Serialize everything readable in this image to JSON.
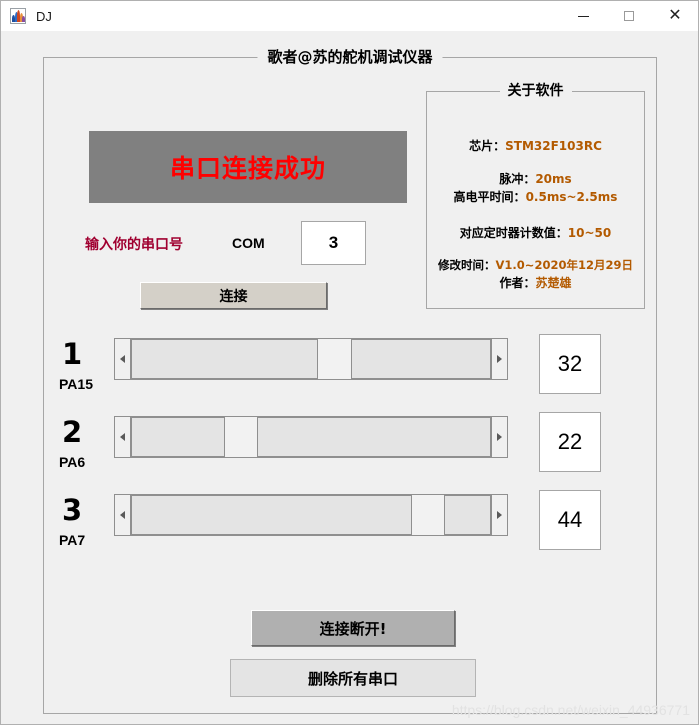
{
  "window": {
    "title": "DJ",
    "icon": "matlab-icon",
    "controls": {
      "minimize": "minimize-icon",
      "maximize": "maximize-icon",
      "close": "close-icon"
    }
  },
  "main_panel": {
    "title": "歌者@苏的舵机调试仪器"
  },
  "status": {
    "text": "串口连接成功",
    "text_color": "#ff0000",
    "background_color": "#808080"
  },
  "com": {
    "prompt": "输入你的串口号",
    "prompt_color": "#a00030",
    "label": "COM",
    "value": "3",
    "placeholder": ""
  },
  "buttons": {
    "connect": "连接",
    "disconnect": "连接断开!",
    "clear_ports": "删除所有串口"
  },
  "about": {
    "title": "关于软件",
    "chip_label": "芯片：",
    "chip_value": "STM32F103RC",
    "pulse_label": "脉冲：",
    "pulse_value": "20ms",
    "high_label": "高电平时间：",
    "high_value": "0.5ms~2.5ms",
    "timer_label": "对应定时器计数值：",
    "timer_value": "10~50",
    "version_label": "修改时间：",
    "version_value": "V1.0~2020年12月29日",
    "author_label": "作者：",
    "author_value": "苏楚雄",
    "value_color": "#b35a00"
  },
  "sliders": [
    {
      "index": "1",
      "pin": "PA15",
      "value": "32",
      "thumb_percent": 55
    },
    {
      "index": "2",
      "pin": "PA6",
      "value": "22",
      "thumb_percent": 30
    },
    {
      "index": "3",
      "pin": "PA7",
      "value": "44",
      "thumb_percent": 81
    }
  ],
  "watermark": {
    "text": "https://blog.csdn.net/weixin_44936771"
  }
}
